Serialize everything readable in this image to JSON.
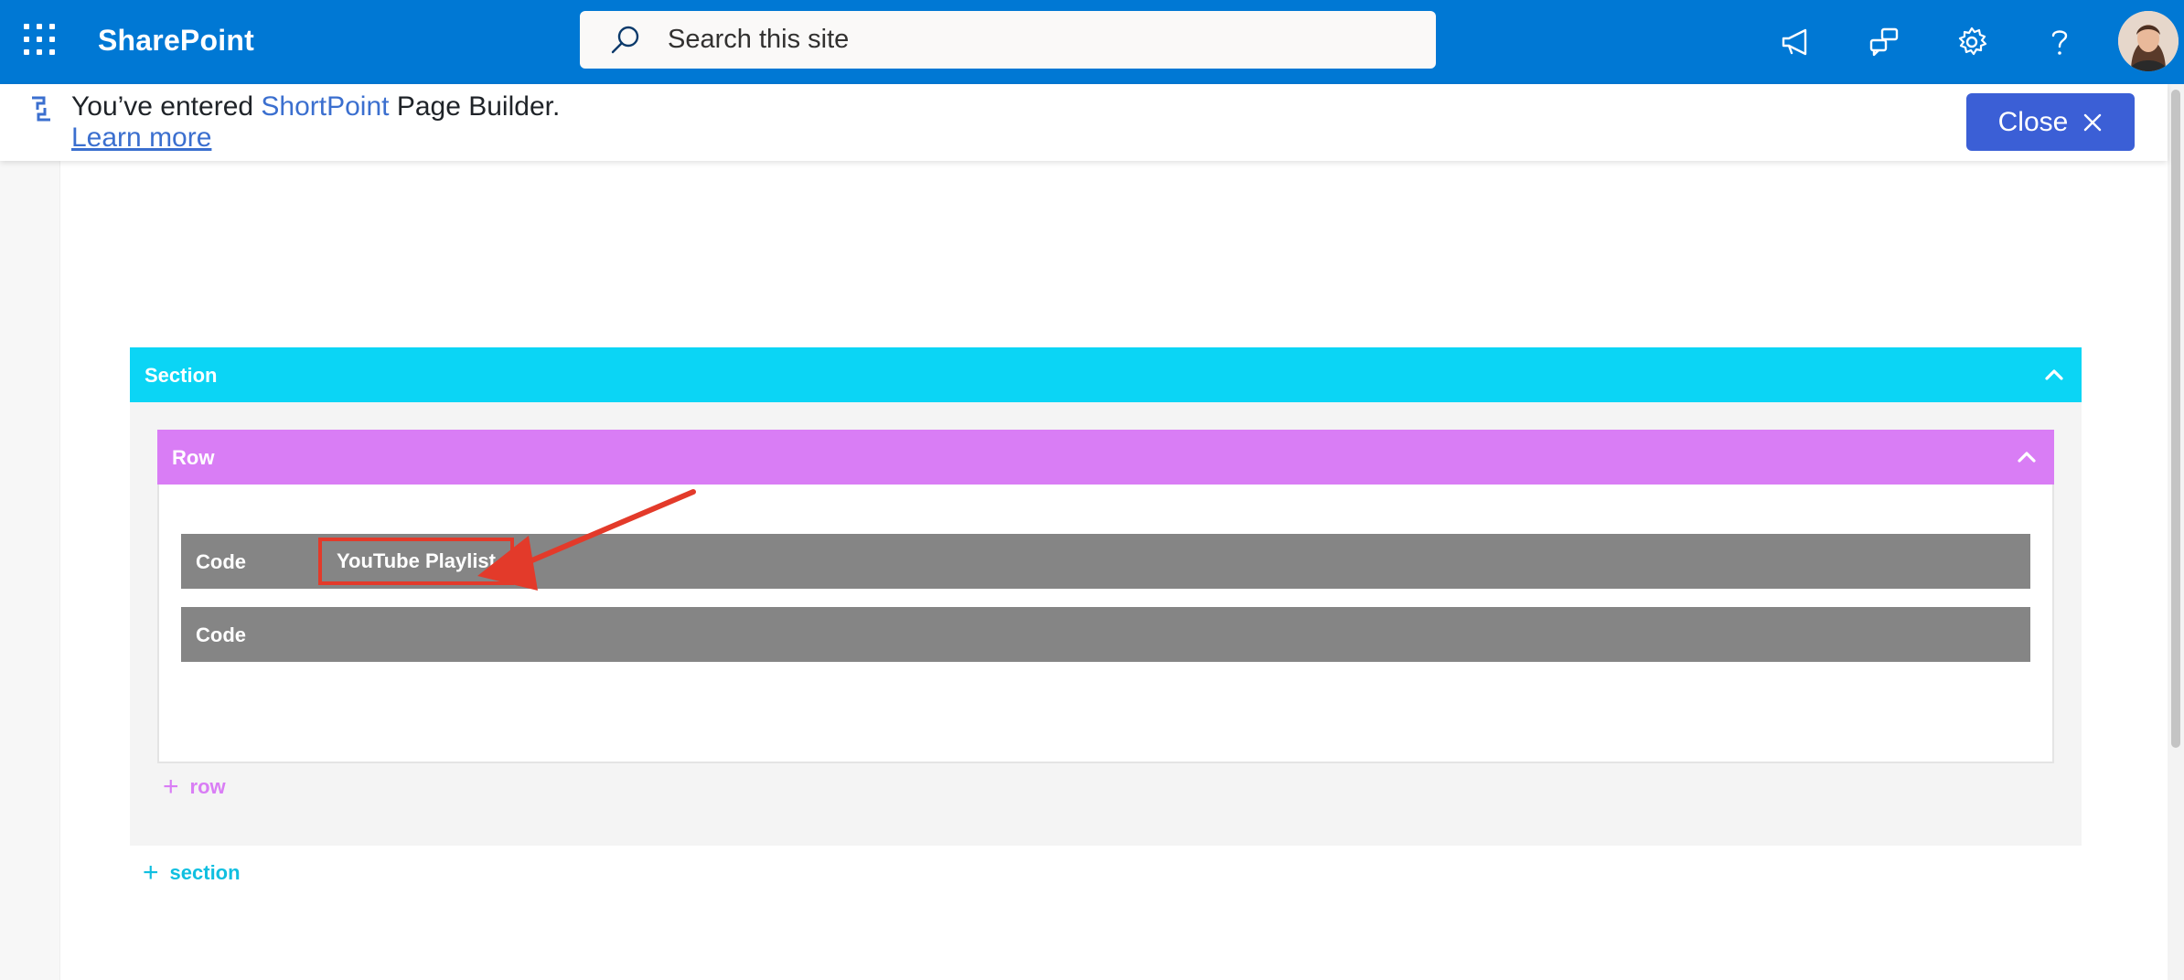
{
  "suite_bar": {
    "brand": "SharePoint",
    "search_placeholder": "Search this site",
    "icons": [
      "app-launcher-icon",
      "megaphone-icon",
      "chat-icon",
      "gear-icon",
      "help-icon"
    ],
    "accent_color": "#0078d4"
  },
  "banner": {
    "message_prefix": "You’ve entered ",
    "message_accent": "ShortPoint",
    "message_suffix": " Page Builder.",
    "learn_more": "Learn more",
    "close_label": "Close"
  },
  "builder": {
    "section_label": "Section",
    "row_label": "Row",
    "code_blocks": [
      {
        "label": "Code",
        "tag": "YouTube Playlist"
      },
      {
        "label": "Code",
        "tag": ""
      }
    ],
    "add_row_label": "row",
    "add_section_label": "section",
    "colors": {
      "section": "#0bd5f5",
      "row": "#d97df5",
      "code": "#858585",
      "highlight": "#e33a2a"
    }
  }
}
